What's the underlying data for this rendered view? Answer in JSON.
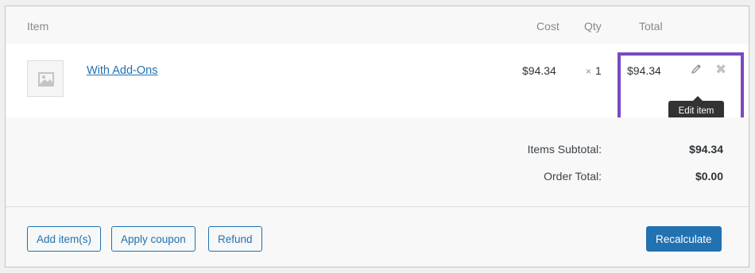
{
  "columns": {
    "item": "Item",
    "cost": "Cost",
    "qty": "Qty",
    "total": "Total"
  },
  "line_item": {
    "name": "With Add-Ons",
    "cost": "$94.34",
    "qty_prefix": "×",
    "qty": "1",
    "total": "$94.34",
    "edit_tooltip": "Edit item",
    "edit_icon": "pencil-icon",
    "delete_icon": "close-icon",
    "thumbnail_icon": "image-placeholder-icon"
  },
  "totals": {
    "subtotal_label": "Items Subtotal:",
    "subtotal_value": "$94.34",
    "order_total_label": "Order Total:",
    "order_total_value": "$0.00"
  },
  "buttons": {
    "add_items": "Add item(s)",
    "apply_coupon": "Apply coupon",
    "refund": "Refund",
    "recalculate": "Recalculate"
  },
  "colors": {
    "link": "#2271b1",
    "primary_button": "#2271b1",
    "highlight_border": "#7b48c4",
    "tooltip_bg": "#333333"
  }
}
